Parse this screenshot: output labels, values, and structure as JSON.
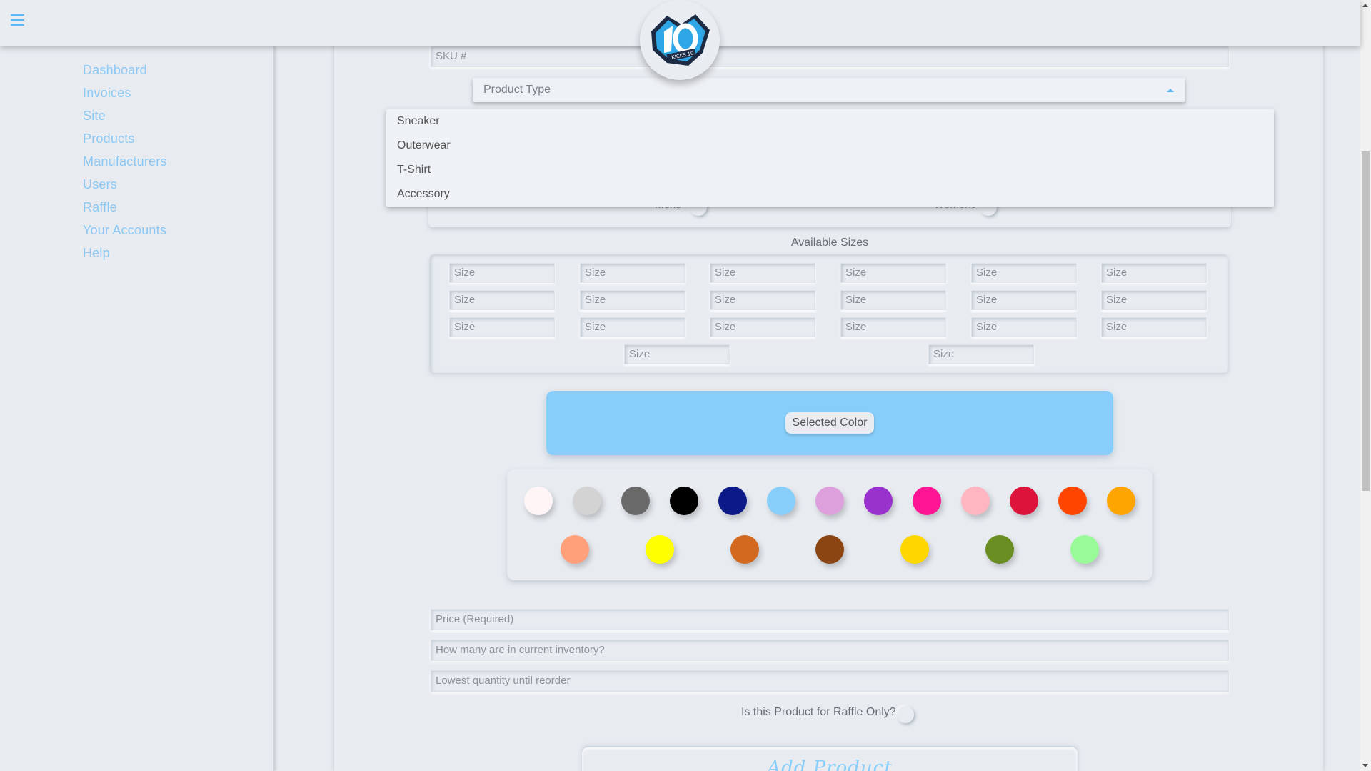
{
  "header": {
    "menu_icon": "hamburger-menu-icon",
    "logo_text": "KICKS 10"
  },
  "sidebar": {
    "items": [
      {
        "label": "Dashboard"
      },
      {
        "label": "Invoices"
      },
      {
        "label": "Site"
      },
      {
        "label": "Products"
      },
      {
        "label": "Manufacturers"
      },
      {
        "label": "Users"
      },
      {
        "label": "Raffle"
      },
      {
        "label": "Your Accounts"
      },
      {
        "label": "Help"
      }
    ]
  },
  "form": {
    "sku_placeholder": "SKU #",
    "product_type_label": "Product Type",
    "product_type_options": [
      "Sneaker",
      "Outerwear",
      "T-Shirt",
      "Accessory"
    ],
    "gender": {
      "mens_label": "Mens",
      "womens_label": "Womens"
    },
    "available_sizes_title": "Available Sizes",
    "size_placeholder": "Size",
    "selected_color_label": "Selected Color",
    "selected_color": "#87cefa",
    "colors_row1": [
      "#fff5f7",
      "#d3d3d3",
      "#696969",
      "#000000",
      "#0b1a87",
      "#87cefa",
      "#dda0dd",
      "#9932cc",
      "#ff1493",
      "#ffb6c1",
      "#dc143c",
      "#ff4500",
      "#ffa500"
    ],
    "colors_row2": [
      "#ffa07a",
      "#ffff00",
      "#d2691e",
      "#8b4513",
      "#ffd700",
      "#6b8e23",
      "#98fb98"
    ],
    "price_placeholder": "Price (Required)",
    "inventory_placeholder": "How many are in current inventory?",
    "reorder_placeholder": "Lowest quantity until reorder",
    "raffle_question": "Is this Product for Raffle Only?",
    "submit_label": "Add Product"
  },
  "colors": {
    "accent": "#87cefa",
    "sidebar_link": "#8cc8f3",
    "background": "#e8ecf1"
  }
}
